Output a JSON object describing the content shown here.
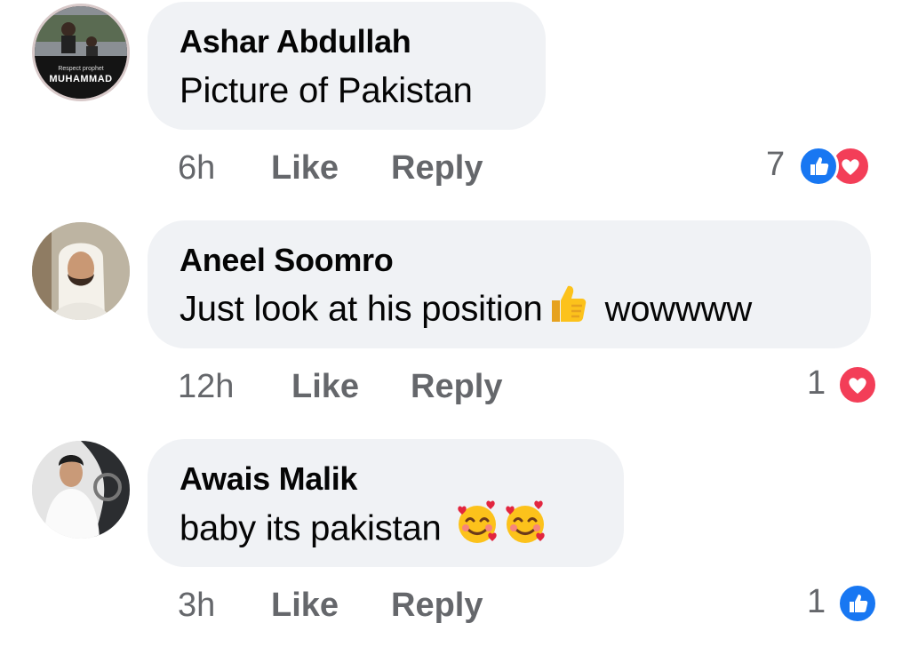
{
  "comments": [
    {
      "author": "Ashar Abdullah",
      "text": "Picture of Pakistan",
      "time": "6h",
      "like_label": "Like",
      "reply_label": "Reply",
      "reaction_count": "7",
      "reactions": [
        "like-icon",
        "love-icon"
      ],
      "avatar_text": [
        "Respect prophet",
        "MUHAMMAD"
      ]
    },
    {
      "author": "Aneel Soomro",
      "text_before": "Just look at his position",
      "text_after": "wowwww",
      "emoji": "thumbs-up-emoji",
      "time": "12h",
      "like_label": "Like",
      "reply_label": "Reply",
      "reaction_count": "1",
      "reactions": [
        "love-icon"
      ]
    },
    {
      "author": "Awais Malik",
      "text": "baby its pakistan",
      "emoji": "smiling-face-with-hearts-emoji",
      "time": "3h",
      "like_label": "Like",
      "reply_label": "Reply",
      "reaction_count": "1",
      "reactions": [
        "like-icon"
      ]
    }
  ],
  "colors": {
    "bubble": "#f0f2f5",
    "like": "#1877f2",
    "love": "#f33e58",
    "meta_text": "#65676b"
  }
}
